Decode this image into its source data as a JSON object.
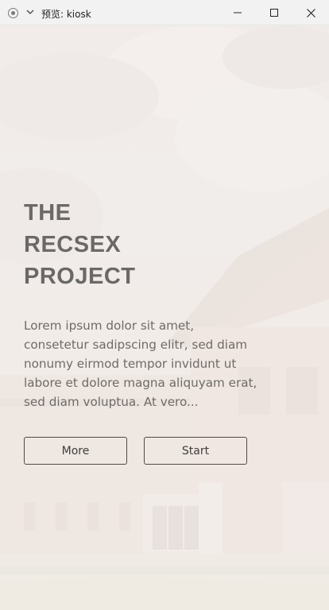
{
  "window": {
    "title": "预览: kiosk",
    "icons": {
      "app": "record-icon",
      "menu": "chevron-down-icon",
      "minimize": "minimize-icon",
      "maximize": "maximize-icon",
      "close": "close-icon"
    }
  },
  "hero": {
    "title_lines": [
      "THE",
      "RECSEX",
      "PROJECT"
    ],
    "description": "Lorem ipsum dolor sit amet, consetetur sadipscing elitr, sed diam nonumy eirmod tempor invidunt ut labore et dolore magna aliquyam erat, sed diam voluptua. At vero..."
  },
  "buttons": {
    "more_label": "More",
    "start_label": "Start"
  },
  "colors": {
    "title": "#6b6966",
    "text": "#6e6b68",
    "button_border": "#4e4b48"
  }
}
